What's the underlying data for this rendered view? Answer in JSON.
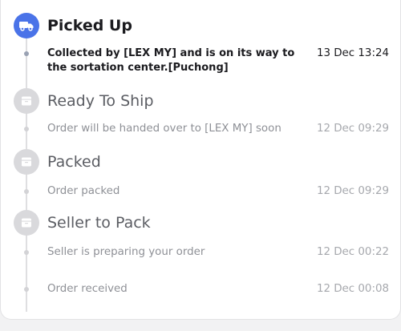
{
  "tracking": {
    "steps": [
      {
        "icon": "truck-icon",
        "title": "Picked Up",
        "events": [
          {
            "description": "Collected by [LEX MY] and is on its way to the sortation center.[Puchong]",
            "time": "13 Dec 13:24"
          }
        ]
      },
      {
        "icon": "box-icon",
        "title": "Ready To Ship",
        "events": [
          {
            "description": "Order will be handed over to [LEX MY] soon",
            "time": "12 Dec 09:29"
          }
        ]
      },
      {
        "icon": "box-icon",
        "title": "Packed",
        "events": [
          {
            "description": "Order packed",
            "time": "12 Dec 09:29"
          }
        ]
      },
      {
        "icon": "box-icon",
        "title": "Seller to Pack",
        "events": [
          {
            "description": "Seller is preparing your order",
            "time": "12 Dec 00:22"
          },
          {
            "description": "Order received",
            "time": "12 Dec 00:08"
          }
        ]
      }
    ]
  },
  "colors": {
    "active": "#4a73e8",
    "inactive": "#d9d9dc",
    "text_dark": "#1b1b1f",
    "text_muted": "#8e9096"
  }
}
